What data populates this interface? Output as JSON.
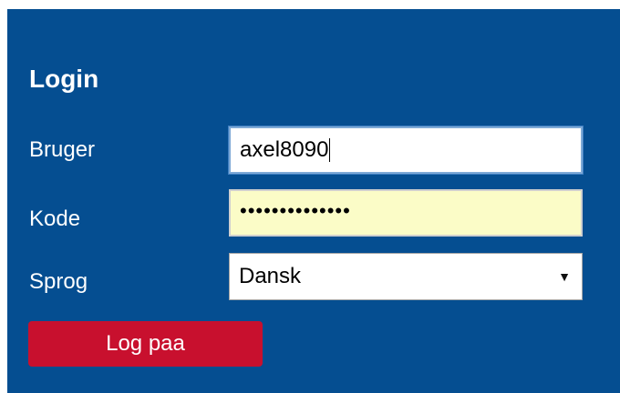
{
  "form": {
    "title": "Login",
    "user_label": "Bruger",
    "user_value": "axel8090",
    "password_label": "Kode",
    "password_masked": "••••••••••••••",
    "language_label": "Sprog",
    "language_selected": "Dansk",
    "language_dropdown_icon": "▼",
    "submit_label": "Log paa"
  },
  "colors": {
    "panel_bg": "#054e91",
    "password_bg": "#fbfcc7",
    "button_bg": "#c8102e"
  }
}
